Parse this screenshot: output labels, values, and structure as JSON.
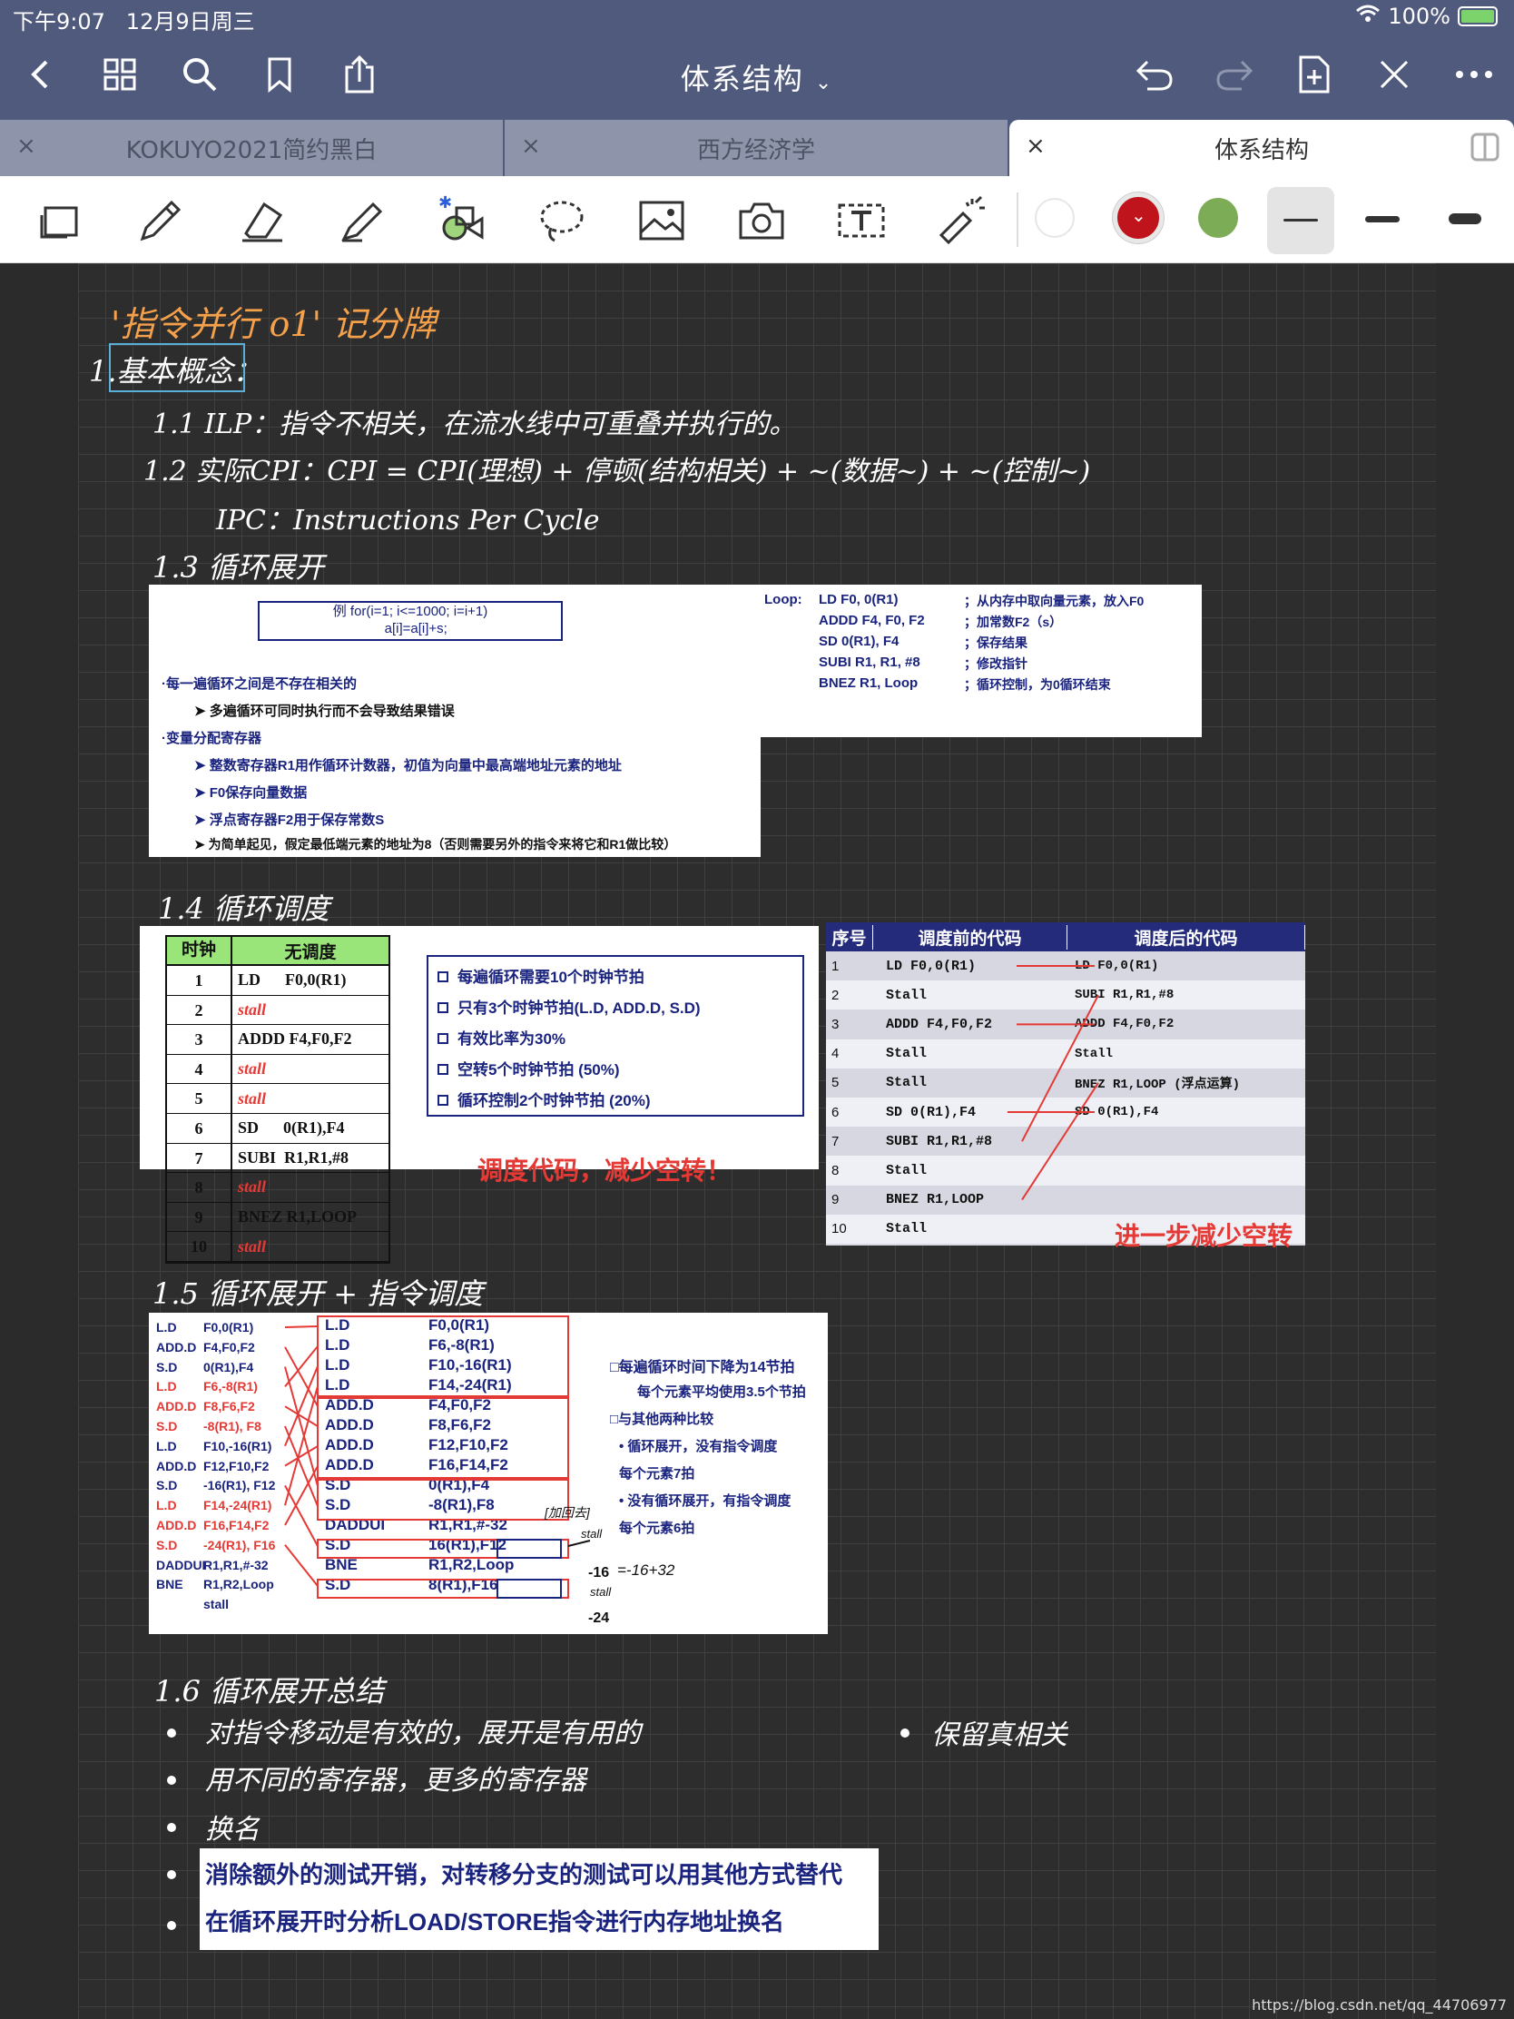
{
  "status": {
    "time": "下午9:07",
    "date": "12月9日周三",
    "battery": "100%"
  },
  "nav": {
    "title": "体系结构"
  },
  "tabs": [
    "KOKUYO2021简约黑白",
    "西方经济学",
    "体系结构"
  ],
  "colors": {
    "nav": "#505a7c",
    "pen_red": "#c0141c",
    "pen_green": "#7cad56",
    "title_orange": "#f5a04a",
    "accent_blue": "#1a237e"
  },
  "notes": {
    "title": "'指令并行 o1' 记分牌",
    "h1": "1.基本概念：",
    "l11": "1.1  ILP：指令不相关，在流水线中可重叠并执行的。",
    "l12": "1.2  实际CPI：CPI = CPI(理想) + 停顿(结构相关) + ~(数据~) + ~(控制~)",
    "ipc": "IPC：Instructions Per Cycle",
    "h13": "1.3  循环展开",
    "h14": "1.4  循环调度",
    "h15": "1.5  循环展开 + 指令调度",
    "h16": "1.6  循环展开总结",
    "s1": "对指令移动是有效的，展开是有用的",
    "s2": "用不同的寄存器，更多的寄存器",
    "s3": "换名",
    "s4": "保留真相关",
    "s5": "消除额外的测试开销，对转移分支的测试可以用其他方式替代",
    "s6": "在循环展开时分析LOAD/STORE指令进行内存地址换名"
  },
  "p13": {
    "example": "例 for(i=1; i<=1000; i=i+1)\n   a[i]=a[i]+s;",
    "b1": "·每一遍循环之间是不存在相关的",
    "b2": "多遍循环可同时执行而不会导致结果错误",
    "b3": "·变量分配寄存器",
    "b4": "整数寄存器R1用作循环计数器，初值为向量中最高端地址元素的地址",
    "b5": "F0保存向量数据",
    "b6": "浮点寄存器F2用于保存常数S",
    "b7": "为简单起见，假定最低端元素的地址为8（否则需要另外的指令来将它和R1做比较）",
    "loop_label": "Loop:",
    "code": [
      [
        "LD F0, 0(R1)",
        "；从内存中取向量元素，放入F0"
      ],
      [
        "ADDD  F4, F0, F2",
        "；加常数F2（s）"
      ],
      [
        "SD 0(R1), F4",
        "；保存结果"
      ],
      [
        "SUBI  R1, R1, #8",
        "；修改指针"
      ],
      [
        "BNEZ  R1, Loop",
        "；循环控制，为0循环结束"
      ]
    ]
  },
  "p14a": {
    "headers": [
      "时钟",
      "无调度"
    ],
    "rows": [
      [
        "1",
        "LD      F0,0(R1)"
      ],
      [
        "2",
        "stall"
      ],
      [
        "3",
        "ADDD F4,F0,F2"
      ],
      [
        "4",
        "stall"
      ],
      [
        "5",
        "stall"
      ],
      [
        "6",
        "SD      0(R1),F4"
      ],
      [
        "7",
        "SUBI  R1,R1,#8"
      ],
      [
        "8",
        "stall"
      ],
      [
        "9",
        "BNEZ R1,LOOP"
      ],
      [
        "10",
        "stall"
      ]
    ],
    "notes": [
      "每遍循环需要10个时钟节拍",
      "只有3个时钟节拍(L.D, ADD.D, S.D)",
      "有效比率为30%",
      "空转5个时钟节拍 (50%)",
      "循环控制2个时钟节拍 (20%)"
    ],
    "slogan": "调度代码，减少空转！"
  },
  "p14b": {
    "headers": [
      "序号",
      "调度前的代码",
      "调度后的代码"
    ],
    "rows": [
      [
        "1",
        "LD F0,0(R1)",
        "LD F0,0(R1)"
      ],
      [
        "2",
        "Stall",
        "SUBI R1,R1,#8"
      ],
      [
        "3",
        "ADDD F4,F0,F2",
        "ADDD F4,F0,F2"
      ],
      [
        "4",
        "Stall",
        "Stall"
      ],
      [
        "5",
        "Stall",
        "BNEZ R1,LOOP (浮点运算)"
      ],
      [
        "6",
        "SD 0(R1),F4",
        "SD 0(R1),F4"
      ],
      [
        "7",
        "SUBI R1,R1,#8",
        ""
      ],
      [
        "8",
        "Stall",
        ""
      ],
      [
        "9",
        "BNEZ R1,LOOP",
        ""
      ],
      [
        "10",
        "Stall",
        ""
      ]
    ],
    "footer": "进一步减少空转"
  },
  "p15": {
    "left": [
      [
        "L.D",
        "F0,0(R1)"
      ],
      [
        "ADD.D",
        "F4,F0,F2"
      ],
      [
        "S.D",
        "0(R1),F4"
      ],
      [
        "L.D",
        "F6,-8(R1)"
      ],
      [
        "ADD.D",
        "F8,F6,F2"
      ],
      [
        "S.D",
        "-8(R1), F8"
      ],
      [
        "L.D",
        "F10,-16(R1)"
      ],
      [
        "ADD.D",
        "F12,F10,F2"
      ],
      [
        "S.D",
        "-16(R1), F12"
      ],
      [
        "L.D",
        "F14,-24(R1)"
      ],
      [
        "ADD.D",
        "F16,F14,F2"
      ],
      [
        "S.D",
        "-24(R1), F16"
      ],
      [
        "DADDUI",
        "R1,R1,#-32"
      ],
      [
        "BNE",
        "R1,R2,Loop"
      ],
      [
        "",
        "stall"
      ]
    ],
    "mid": [
      [
        "L.D",
        "F0,0(R1)"
      ],
      [
        "L.D",
        "F6,-8(R1)"
      ],
      [
        "L.D",
        "F10,-16(R1)"
      ],
      [
        "L.D",
        "F14,-24(R1)"
      ],
      [
        "ADD.D",
        "F4,F0,F2"
      ],
      [
        "ADD.D",
        "F8,F6,F2"
      ],
      [
        "ADD.D",
        "F12,F10,F2"
      ],
      [
        "ADD.D",
        "F16,F14,F2"
      ],
      [
        "S.D",
        "0(R1),F4"
      ],
      [
        "S.D",
        "-8(R1),F8"
      ],
      [
        "DADDUI",
        "R1,R1,#-32"
      ],
      [
        "S.D",
        "16(R1),F12"
      ],
      [
        "BNE",
        "R1,R2,Loop"
      ],
      [
        "S.D",
        "8(R1),F16"
      ]
    ],
    "right": [
      "每遍循环时间下降为14节拍",
      "每个元素平均使用3.5个节拍",
      "与其他两种比较",
      "循环展开，没有指令调度",
      "每个元素7拍",
      "没有循环展开，有指令调度",
      "每个元素6拍"
    ],
    "ann": [
      "加回去",
      "stall",
      "-16",
      "=-16+32",
      "stall",
      "-24"
    ]
  },
  "watermark": "https://blog.csdn.net/qq_44706977"
}
